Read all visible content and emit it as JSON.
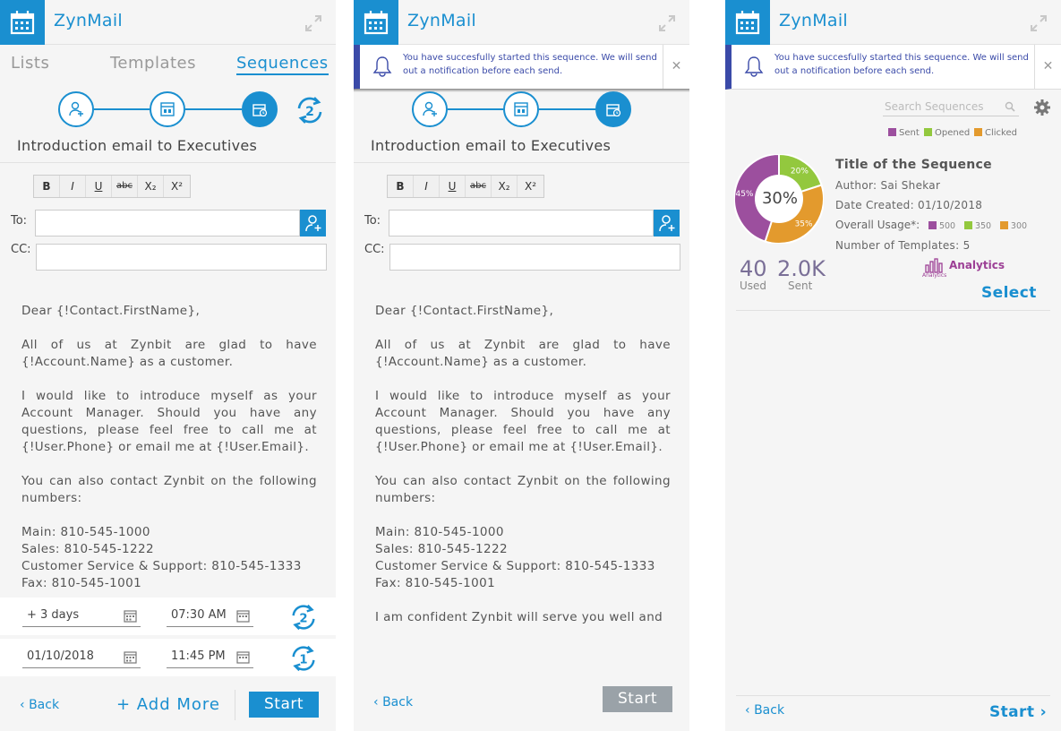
{
  "app": {
    "name": "ZynMail"
  },
  "tabs": [
    "Lists",
    "Templates",
    "Sequences"
  ],
  "notification": {
    "text": "You have succesfully started this sequence. We will send out a notification before each send."
  },
  "email": {
    "title": "Introduction email to Executives",
    "toolbar": [
      "B",
      "I",
      "U",
      "abc",
      "X₂",
      "X²"
    ],
    "to_label": "To:",
    "cc_label": "CC:",
    "to_value": "",
    "cc_value": "",
    "body": [
      "Dear {!Contact.FirstName},",
      "All of us at Zynbit are glad to have {!Account.Name} as a customer.",
      "I would like to introduce myself as your Account Manager. Should you have any questions, please feel free to call me at {!User.Phone} or email me at {!User.Email}.",
      "You can also contact Zynbit on the following numbers:",
      "Main: 810-545-1000",
      "Sales: 810-545-1222",
      "Customer Service & Support: 810-545-1333",
      "Fax: 810-545-1001",
      "I am confident Zynbit will serve you well and"
    ]
  },
  "schedule": [
    {
      "date": "+ 3 days",
      "time": "07:30 AM",
      "step": "2"
    },
    {
      "date": "01/10/2018",
      "time": "11:45 PM",
      "step": "1"
    }
  ],
  "steps_badge": "2",
  "footer": {
    "back": "Back",
    "add_more": "+ Add More",
    "start": "Start"
  },
  "sequences": {
    "search_placeholder": "Search Sequences",
    "legend": [
      {
        "label": "Sent",
        "color": "#9c4f9e"
      },
      {
        "label": "Opened",
        "color": "#93c83e"
      },
      {
        "label": "Clicked",
        "color": "#e39a2d"
      }
    ],
    "item": {
      "title": "Title of the Sequence",
      "author": "Author: Sai Shekar",
      "date_created": "Date Created: 01/10/2018",
      "usage_label": "Overall Usage*:",
      "usage": [
        {
          "value": "500",
          "color": "#9c4f9e"
        },
        {
          "value": "350",
          "color": "#93c83e"
        },
        {
          "value": "300",
          "color": "#e39a2d"
        }
      ],
      "templates": "Number of Templates: 5",
      "center_pct": "30%",
      "slices": [
        {
          "label": "45%",
          "value": 45,
          "color": "#9c4f9e"
        },
        {
          "label": "20%",
          "value": 20,
          "color": "#93c83e"
        },
        {
          "label": "35%",
          "value": 35,
          "color": "#e39a2d"
        }
      ],
      "used": "40",
      "used_label": "Used",
      "sent": "2.0K",
      "sent_label": "Sent",
      "analytics": "Analytics",
      "analytics_small": "Analytics",
      "select": "Select"
    }
  }
}
